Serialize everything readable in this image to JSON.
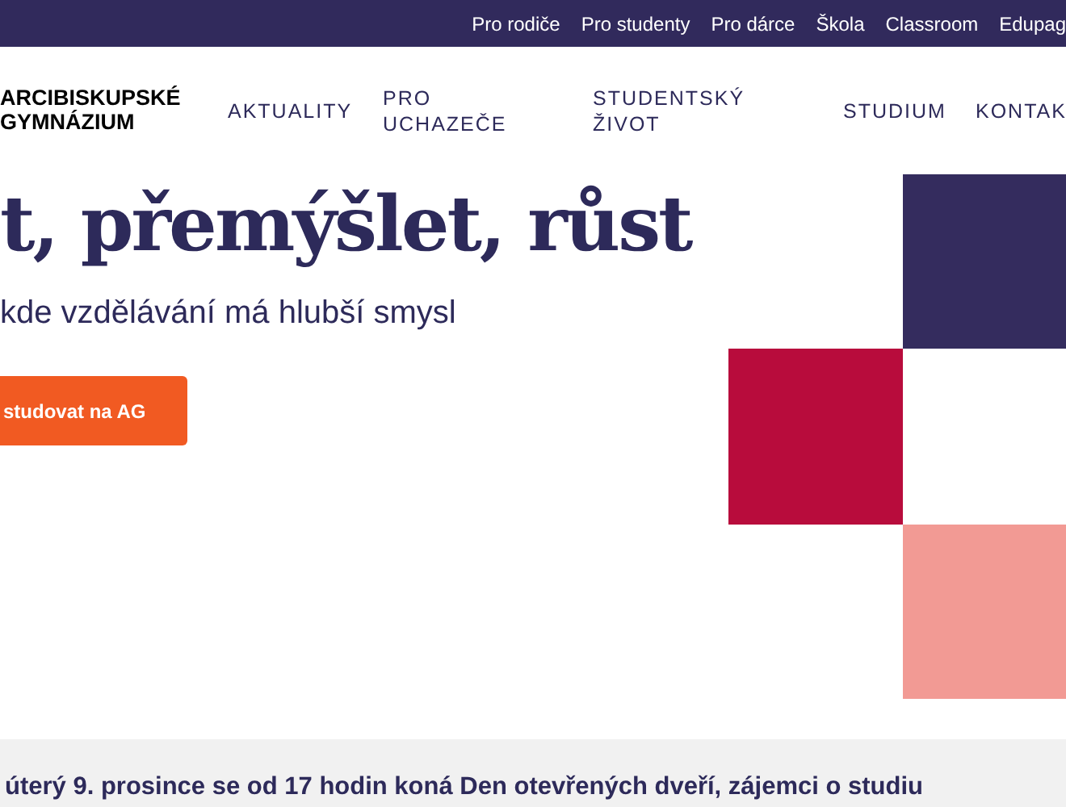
{
  "top_links": [
    "Pro rodiče",
    "Pro studenty",
    "Pro dárce",
    "Škola",
    "Classroom",
    "Edupag"
  ],
  "logo": [
    "ARCIBISKUPSKÉ",
    "GYMNÁZIUM"
  ],
  "nav": [
    [
      "AKTUALITY"
    ],
    [
      "PRO",
      "UCHAZEČE"
    ],
    [
      "STUDENTSKÝ",
      "ŽIVOT"
    ],
    [
      "STUDIUM"
    ],
    [
      "KONTAK"
    ]
  ],
  "hero": {
    "title": "t, přemýšlet, růst",
    "subtitle": "kde vzdělávání má hlubší smysl",
    "button": "studovat na AG"
  },
  "notice": "úterý 9. prosince se od 17 hodin koná Den otevřených dveří, zájemci o studiu"
}
